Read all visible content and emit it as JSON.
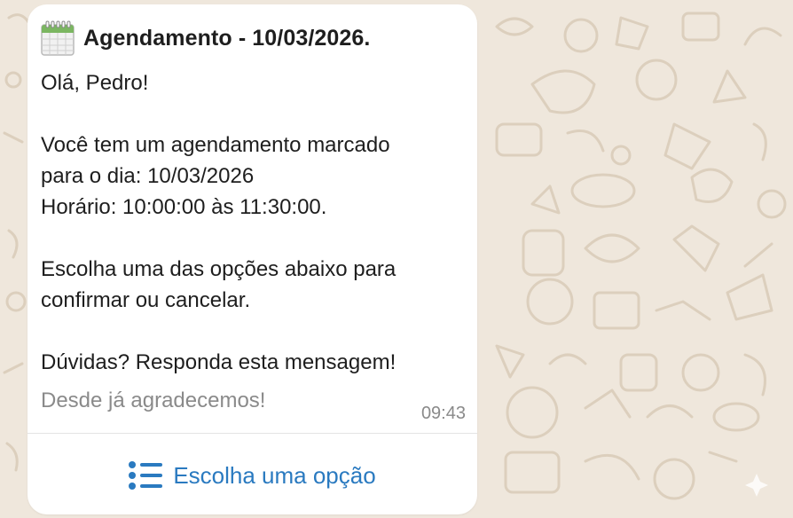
{
  "background": {
    "color": "#efe7dc",
    "doodle_color": "#dccfbd"
  },
  "message": {
    "header_icon": "calendar-icon",
    "title": "Agendamento - 10/03/2026.",
    "greeting": "Olá, Pedro!",
    "lines": [
      "Você tem um agendamento marcado",
      "para o dia: 10/03/2026",
      "Horário: 10:00:00 às 11:30:00."
    ],
    "instructions": [
      "Escolha uma das opções abaixo para",
      "confirmar ou cancelar."
    ],
    "questions": "Dúvidas? Responda esta mensagem!",
    "footer": "Desde já agradecemos!",
    "time": "09:43",
    "text_color": "#1e1e1e",
    "footer_color": "#8a8a8a"
  },
  "action_button": {
    "icon": "list-icon",
    "label": "Escolha uma opção",
    "color": "#2a7ac0"
  }
}
